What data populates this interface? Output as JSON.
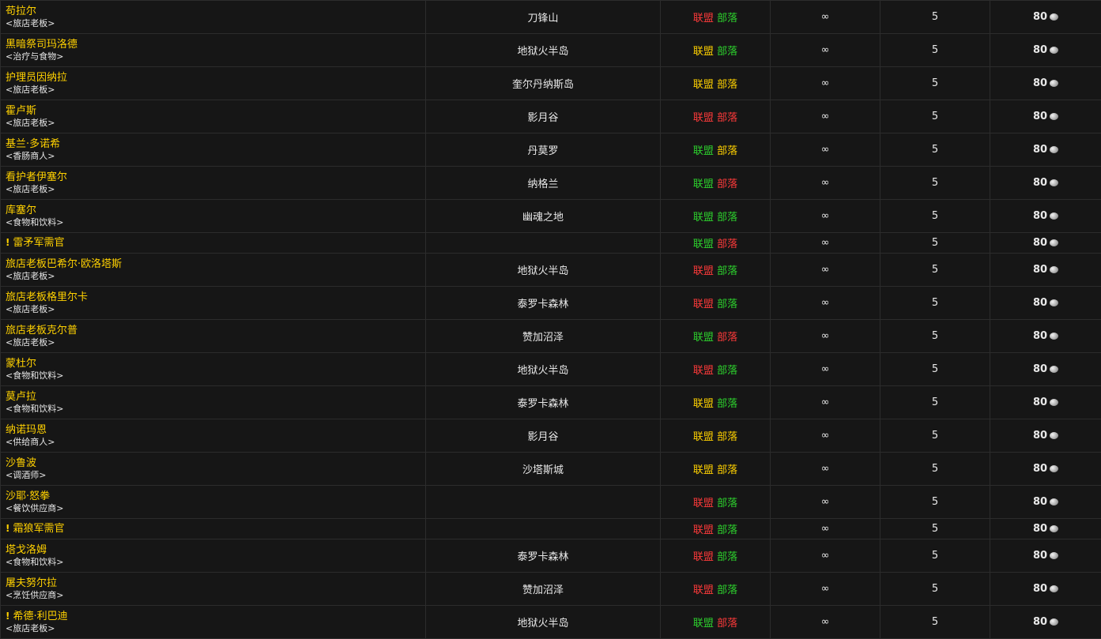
{
  "rows": [
    {
      "name": "苟拉尔",
      "tag": "<旅店老板>",
      "zone": "刀锋山",
      "alliance": "联盟",
      "horde": "部落",
      "alliance_color": "hostile",
      "horde_color": "friendly",
      "stock": "∞",
      "qty": "5",
      "cost": "80",
      "quest": false
    },
    {
      "name": "黑暗祭司玛洛德",
      "tag": "<治疗与食物>",
      "zone": "地狱火半岛",
      "alliance": "联盟",
      "horde": "部落",
      "alliance_color": "neutral",
      "horde_color": "friendly",
      "stock": "∞",
      "qty": "5",
      "cost": "80",
      "quest": false
    },
    {
      "name": "护理员因纳拉",
      "tag": "<旅店老板>",
      "zone": "奎尔丹纳斯岛",
      "alliance": "联盟",
      "horde": "部落",
      "alliance_color": "neutral",
      "horde_color": "neutral",
      "stock": "∞",
      "qty": "5",
      "cost": "80",
      "quest": false
    },
    {
      "name": "霍卢斯",
      "tag": "<旅店老板>",
      "zone": "影月谷",
      "alliance": "联盟",
      "horde": "部落",
      "alliance_color": "hostile",
      "horde_color": "hostile",
      "stock": "∞",
      "qty": "5",
      "cost": "80",
      "quest": false
    },
    {
      "name": "基兰·多诺希",
      "tag": "<香肠商人>",
      "zone": "丹莫罗",
      "alliance": "联盟",
      "horde": "部落",
      "alliance_color": "friendly",
      "horde_color": "neutral",
      "stock": "∞",
      "qty": "5",
      "cost": "80",
      "quest": false
    },
    {
      "name": "看护者伊塞尔",
      "tag": "<旅店老板>",
      "zone": "纳格兰",
      "alliance": "联盟",
      "horde": "部落",
      "alliance_color": "friendly",
      "horde_color": "hostile",
      "stock": "∞",
      "qty": "5",
      "cost": "80",
      "quest": false
    },
    {
      "name": "库塞尔",
      "tag": "<食物和饮料>",
      "zone": "幽魂之地",
      "alliance": "联盟",
      "horde": "部落",
      "alliance_color": "friendly",
      "horde_color": "friendly",
      "stock": "∞",
      "qty": "5",
      "cost": "80",
      "quest": false
    },
    {
      "name": "雷矛军需官",
      "tag": "",
      "zone": "",
      "alliance": "联盟",
      "horde": "部落",
      "alliance_color": "friendly",
      "horde_color": "hostile",
      "stock": "∞",
      "qty": "5",
      "cost": "80",
      "quest": true
    },
    {
      "name": "旅店老板巴希尔·欧洛塔斯",
      "tag": "<旅店老板>",
      "zone": "地狱火半岛",
      "alliance": "联盟",
      "horde": "部落",
      "alliance_color": "hostile",
      "horde_color": "friendly",
      "stock": "∞",
      "qty": "5",
      "cost": "80",
      "quest": false
    },
    {
      "name": "旅店老板格里尔卡",
      "tag": "<旅店老板>",
      "zone": "泰罗卡森林",
      "alliance": "联盟",
      "horde": "部落",
      "alliance_color": "hostile",
      "horde_color": "friendly",
      "stock": "∞",
      "qty": "5",
      "cost": "80",
      "quest": false
    },
    {
      "name": "旅店老板克尔普",
      "tag": "<旅店老板>",
      "zone": "赞加沼泽",
      "alliance": "联盟",
      "horde": "部落",
      "alliance_color": "friendly",
      "horde_color": "hostile",
      "stock": "∞",
      "qty": "5",
      "cost": "80",
      "quest": false
    },
    {
      "name": "蒙杜尔",
      "tag": "<食物和饮料>",
      "zone": "地狱火半岛",
      "alliance": "联盟",
      "horde": "部落",
      "alliance_color": "hostile",
      "horde_color": "friendly",
      "stock": "∞",
      "qty": "5",
      "cost": "80",
      "quest": false
    },
    {
      "name": "莫卢拉",
      "tag": "<食物和饮料>",
      "zone": "泰罗卡森林",
      "alliance": "联盟",
      "horde": "部落",
      "alliance_color": "neutral",
      "horde_color": "friendly",
      "stock": "∞",
      "qty": "5",
      "cost": "80",
      "quest": false
    },
    {
      "name": "纳诺玛恩",
      "tag": "<供给商人>",
      "zone": "影月谷",
      "alliance": "联盟",
      "horde": "部落",
      "alliance_color": "neutral",
      "horde_color": "neutral",
      "stock": "∞",
      "qty": "5",
      "cost": "80",
      "quest": false
    },
    {
      "name": "沙鲁波",
      "tag": "<调酒师>",
      "zone": "沙塔斯城",
      "alliance": "联盟",
      "horde": "部落",
      "alliance_color": "neutral",
      "horde_color": "neutral",
      "stock": "∞",
      "qty": "5",
      "cost": "80",
      "quest": false
    },
    {
      "name": "沙耶·怒拳",
      "tag": "<餐饮供应商>",
      "zone": "",
      "alliance": "联盟",
      "horde": "部落",
      "alliance_color": "hostile",
      "horde_color": "friendly",
      "stock": "∞",
      "qty": "5",
      "cost": "80",
      "quest": false
    },
    {
      "name": "霜狼军需官",
      "tag": "",
      "zone": "",
      "alliance": "联盟",
      "horde": "部落",
      "alliance_color": "hostile",
      "horde_color": "friendly",
      "stock": "∞",
      "qty": "5",
      "cost": "80",
      "quest": true
    },
    {
      "name": "塔戈洛姆",
      "tag": "<食物和饮料>",
      "zone": "泰罗卡森林",
      "alliance": "联盟",
      "horde": "部落",
      "alliance_color": "hostile",
      "horde_color": "friendly",
      "stock": "∞",
      "qty": "5",
      "cost": "80",
      "quest": false
    },
    {
      "name": "屠夫努尔拉",
      "tag": "<烹饪供应商>",
      "zone": "赞加沼泽",
      "alliance": "联盟",
      "horde": "部落",
      "alliance_color": "hostile",
      "horde_color": "friendly",
      "stock": "∞",
      "qty": "5",
      "cost": "80",
      "quest": false
    },
    {
      "name": "希德·利巴迪",
      "tag": "<旅店老板>",
      "zone": "地狱火半岛",
      "alliance": "联盟",
      "horde": "部落",
      "alliance_color": "friendly",
      "horde_color": "hostile",
      "stock": "∞",
      "qty": "5",
      "cost": "80",
      "quest": true
    }
  ],
  "icons": {
    "quest_marker": "!",
    "currency": "silver-coin-icon"
  },
  "colors": {
    "hostile": "#ff3a3a",
    "neutral": "#ffd100",
    "friendly": "#2dd22d",
    "name": "#ffd100"
  }
}
